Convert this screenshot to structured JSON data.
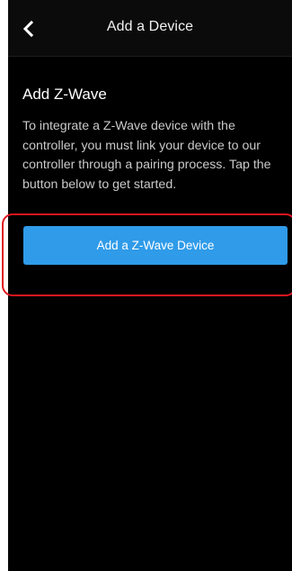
{
  "header": {
    "back_icon": "chevron-left-icon",
    "title": "Add a Device"
  },
  "content": {
    "section_title": "Add Z-Wave",
    "description": "To integrate a Z-Wave device with the controller, you must link your device to our controller through a pairing process. Tap the button below to get started.",
    "primary_button_label": "Add a Z-Wave Device"
  },
  "colors": {
    "background": "#000000",
    "header_background": "#0b0b0b",
    "button_blue": "#2f9be9",
    "highlight_red": "#e0161e",
    "body_text": "#c9c9c9"
  }
}
